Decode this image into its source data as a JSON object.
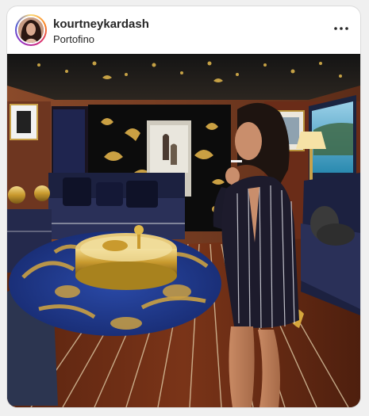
{
  "post": {
    "username": "kourtneykardash",
    "location": "Portofino"
  },
  "icons": {
    "more": "more-options-icon",
    "avatar": "profile-avatar"
  },
  "colors": {
    "username": "#262626",
    "card_border": "#dbdbdb",
    "story_ring": "#d62976"
  }
}
